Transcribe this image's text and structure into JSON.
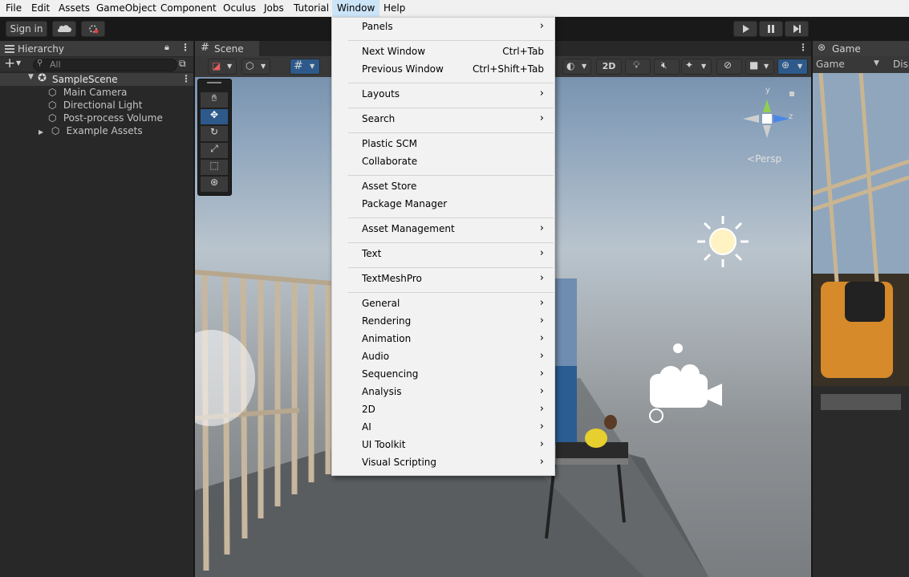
{
  "menubar": {
    "file": "File",
    "edit": "Edit",
    "assets": "Assets",
    "gameobject": "GameObject",
    "component": "Component",
    "oculus": "Oculus",
    "jobs": "Jobs",
    "tutorial": "Tutorial",
    "window": "Window",
    "help": "Help"
  },
  "toolbar": {
    "sign_in": "Sign in"
  },
  "hierarchy": {
    "tab": "Hierarchy",
    "search_placeholder": "All",
    "scene": "SampleScene",
    "items": [
      "Main Camera",
      "Directional Light",
      "Post-process Volume",
      "Example Assets"
    ]
  },
  "scene": {
    "tab": "Scene",
    "mode_2d": "2D",
    "gizmo_y": "y",
    "gizmo_z": "z",
    "persp": "Persp"
  },
  "game": {
    "tab": "Game",
    "display": "Game",
    "display_cut": "Disp"
  },
  "window_menu": {
    "panels": "Panels",
    "next_window": "Next Window",
    "next_window_shortcut": "Ctrl+Tab",
    "previous_window": "Previous Window",
    "previous_window_shortcut": "Ctrl+Shift+Tab",
    "layouts": "Layouts",
    "search": "Search",
    "plastic_scm": "Plastic SCM",
    "collaborate": "Collaborate",
    "asset_store": "Asset Store",
    "package_manager": "Package Manager",
    "asset_management": "Asset Management",
    "text": "Text",
    "textmeshpro": "TextMeshPro",
    "general": "General",
    "rendering": "Rendering",
    "animation": "Animation",
    "audio": "Audio",
    "sequencing": "Sequencing",
    "analysis": "Analysis",
    "two_d": "2D",
    "ai": "AI",
    "ui_toolkit": "UI Toolkit",
    "visual_scripting": "Visual Scripting"
  },
  "colors": {
    "menu_bg": "#f2f2f2",
    "editor_dark": "#191919",
    "panel": "#282828",
    "accent": "#2d5a8a"
  }
}
